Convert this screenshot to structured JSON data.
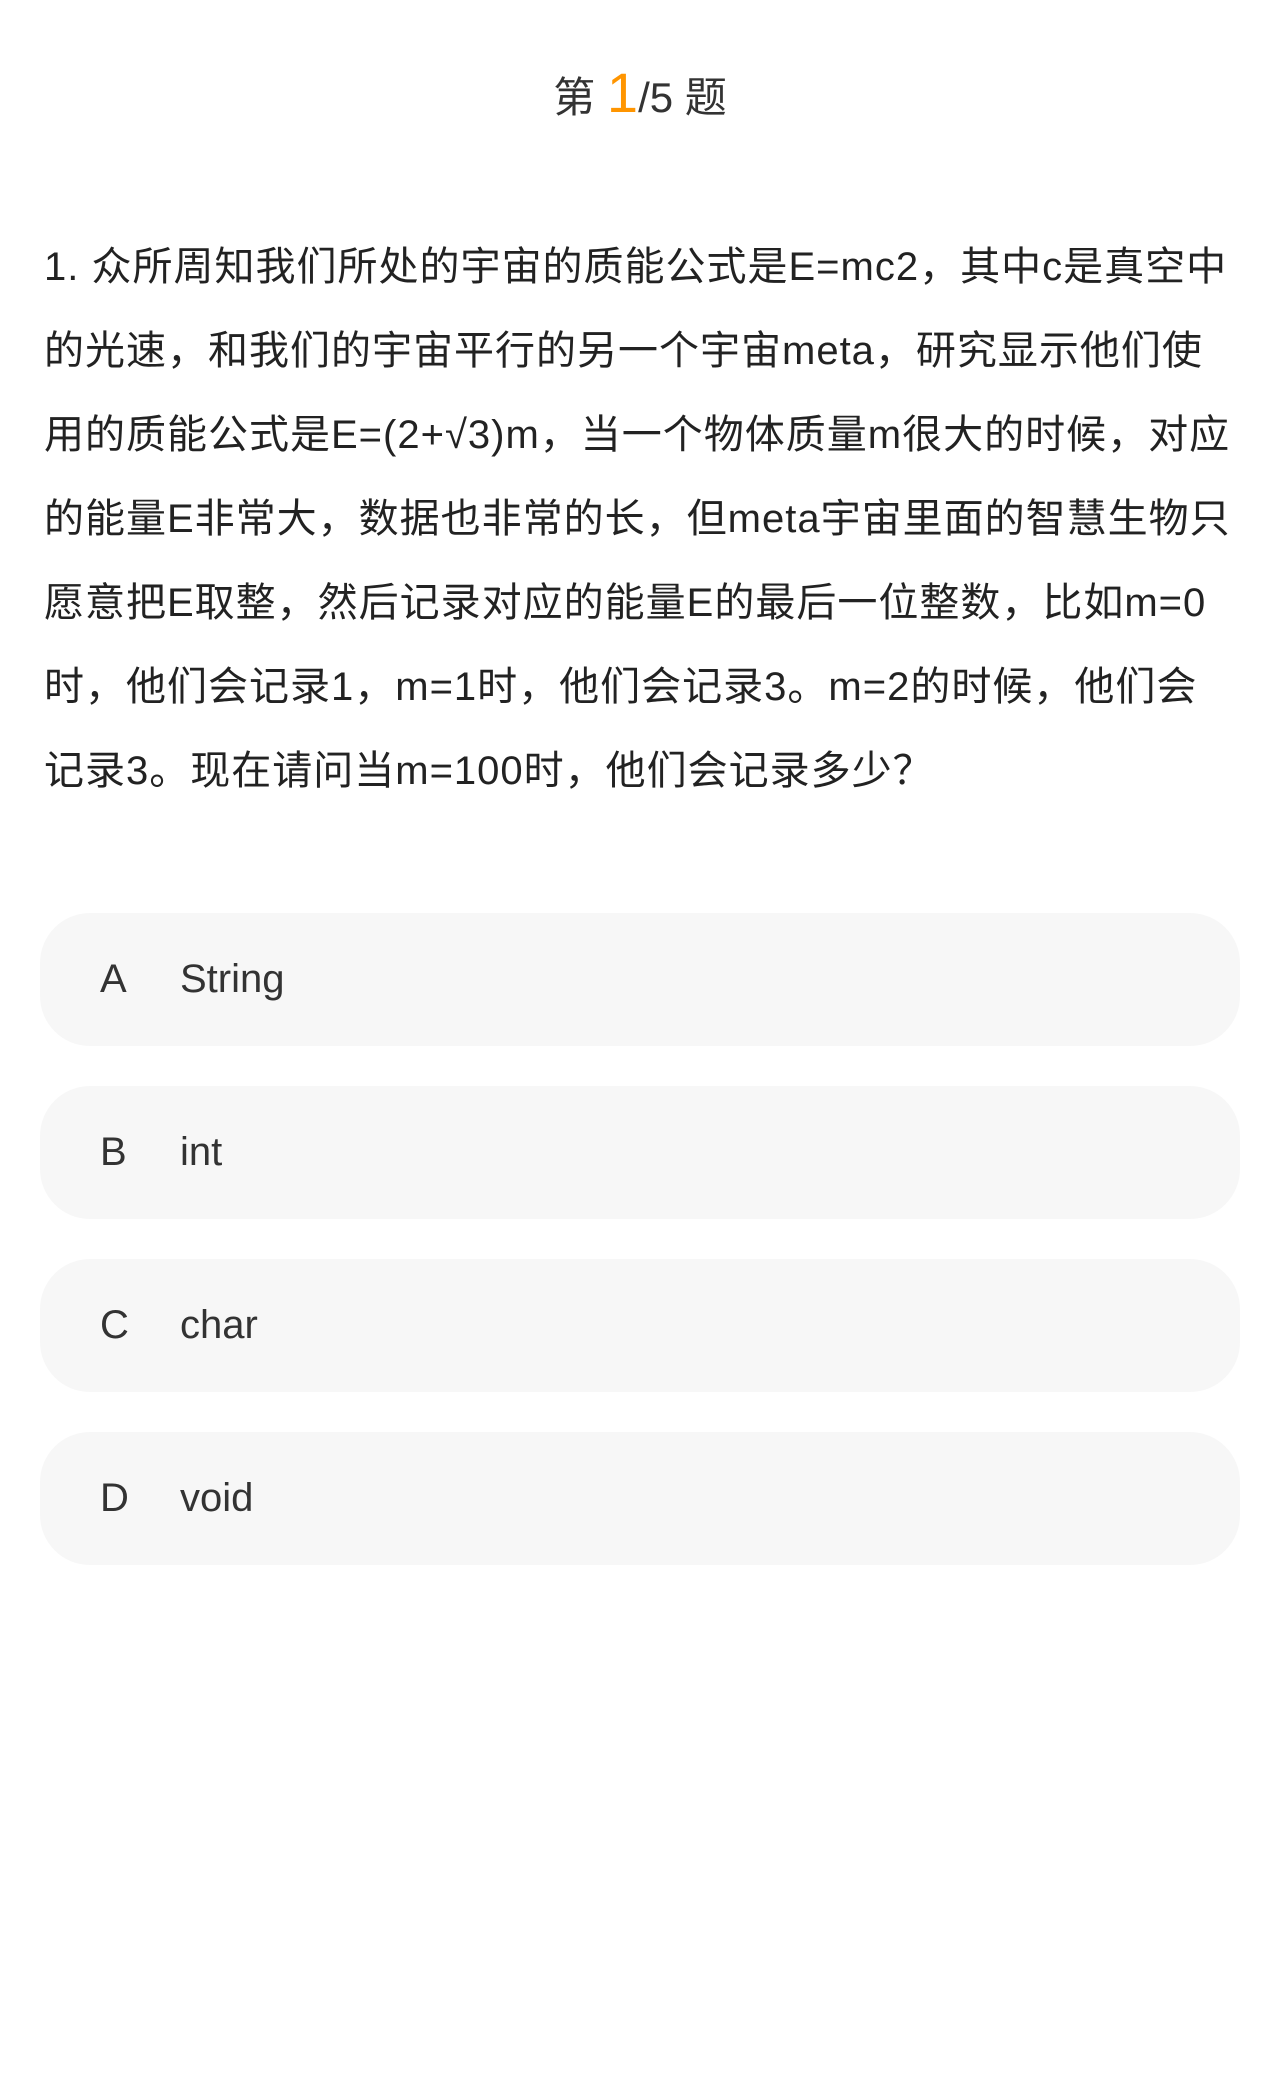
{
  "progress": {
    "prefix": "第 ",
    "current": "1",
    "total": "/5 题"
  },
  "question": {
    "number": "1. ",
    "text": "众所周知我们所处的宇宙的质能公式是E=mc2，其中c是真空中的光速，和我们的宇宙平行的另一个宇宙meta，研究显示他们使用的质能公式是E=(2+√3)m，当一个物体质量m很大的时候，对应的能量E非常大，数据也非常的长，但meta宇宙里面的智慧生物只愿意把E取整，然后记录对应的能量E的最后一位整数，比如m=0时，他们会记录1，m=1时，他们会记录3。m=2的时候，他们会记录3。现在请问当m=100时，他们会记录多少？"
  },
  "options": [
    {
      "letter": "A",
      "text": "String"
    },
    {
      "letter": "B",
      "text": "int"
    },
    {
      "letter": "C",
      "text": "char"
    },
    {
      "letter": "D",
      "text": "void"
    }
  ]
}
